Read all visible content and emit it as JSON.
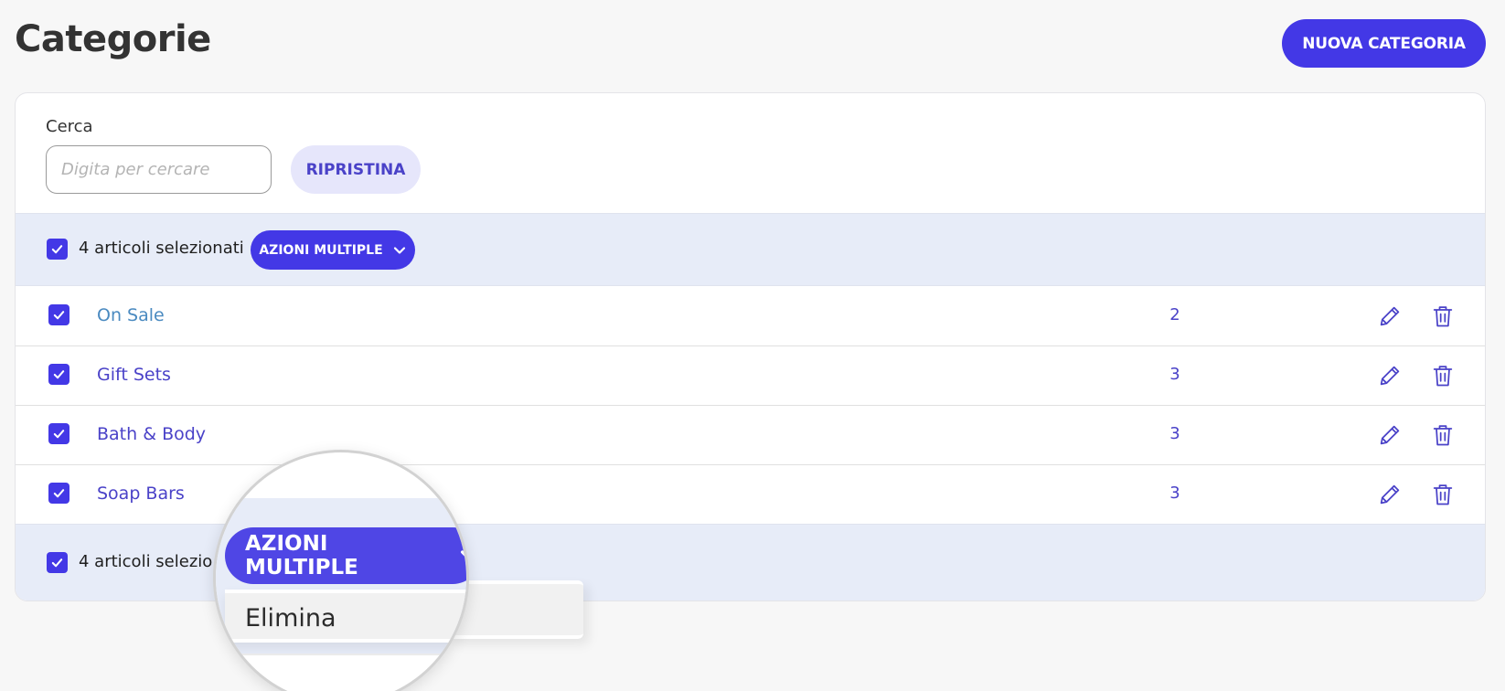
{
  "page": {
    "title": "Categorie"
  },
  "header": {
    "new_button_label": "NUOVA CATEGORIA"
  },
  "search": {
    "label": "Cerca",
    "placeholder": "Digita per cercare",
    "value": "",
    "reset_label": "RIPRISTINA"
  },
  "bulk": {
    "selected_text": "4 articoli selezionati",
    "selected_text_truncated": "4 articoli selezio",
    "actions_label": "AZIONI MULTIPLE"
  },
  "rows": [
    {
      "name": "On Sale",
      "count": "2",
      "checked": true
    },
    {
      "name": "Gift Sets",
      "count": "3",
      "checked": true
    },
    {
      "name": "Bath & Body",
      "count": "3",
      "checked": true
    },
    {
      "name": "Soap Bars",
      "count": "3",
      "checked": true
    }
  ],
  "dropdown": {
    "items": [
      "Elimina"
    ]
  },
  "colors": {
    "accent": "#4338e6",
    "accent_light": "#e6e6fb",
    "bulk_bg": "#e7ecf8",
    "link": "#4a8ac0"
  },
  "icons": {
    "checkbox": "check-icon",
    "edit": "pencil-icon",
    "delete": "trash-icon",
    "caret": "chevron-down-icon"
  }
}
